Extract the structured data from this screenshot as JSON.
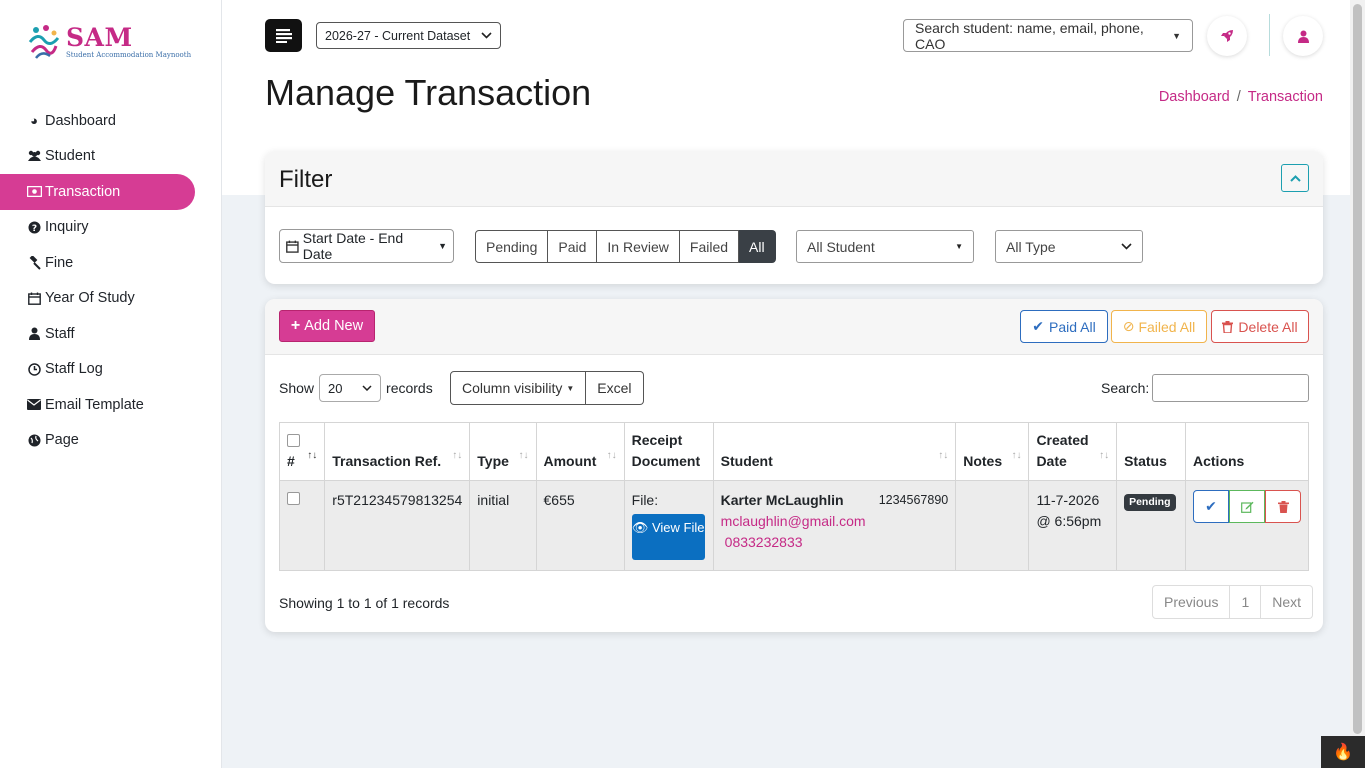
{
  "brand": {
    "title": "SAM",
    "subtitle": "Student Accommodation Maynooth"
  },
  "sidebar": {
    "items": [
      {
        "label": "Dashboard",
        "icon": "tachometer-icon",
        "glyph": "◕"
      },
      {
        "label": "Student",
        "icon": "users-icon",
        "glyph": "👥"
      },
      {
        "label": "Transaction",
        "icon": "money-bill-icon",
        "glyph": "💵",
        "active": true
      },
      {
        "label": "Inquiry",
        "icon": "question-circle-icon",
        "glyph": "❓"
      },
      {
        "label": "Fine",
        "icon": "gavel-icon",
        "glyph": "⚒"
      },
      {
        "label": "Year Of Study",
        "icon": "calendar-icon",
        "glyph": "📅"
      },
      {
        "label": "Staff",
        "icon": "user-icon",
        "glyph": "👤"
      },
      {
        "label": "Staff Log",
        "icon": "clock-icon",
        "glyph": "⏱"
      },
      {
        "label": "Email Template",
        "icon": "envelope-icon",
        "glyph": "✉"
      },
      {
        "label": "Page",
        "icon": "globe-icon",
        "glyph": "🌐"
      }
    ]
  },
  "header": {
    "dataset": "2026-27 - Current Dataset",
    "search_placeholder": "Search student: name, email, phone, CAO",
    "page_title": "Manage Transaction",
    "breadcrumb": [
      "Dashboard",
      "Transaction"
    ]
  },
  "filter": {
    "title": "Filter",
    "date_range": "Start Date - End Date",
    "statuses": [
      "Pending",
      "Paid",
      "In Review",
      "Failed",
      "All"
    ],
    "selected_status": "All",
    "student_select": "All Student",
    "type_select": "All Type"
  },
  "toolbar": {
    "add_new": "Add New",
    "paid_all": "Paid All",
    "failed_all": "Failed All",
    "delete_all": "Delete All"
  },
  "table_controls": {
    "show_label": "Show",
    "page_length": "20",
    "records_label": "records",
    "column_visibility": "Column visibility",
    "excel": "Excel",
    "search_label": "Search:"
  },
  "table": {
    "columns": [
      "#",
      "Transaction Ref.",
      "Type",
      "Amount",
      "Receipt Document",
      "Student",
      "Notes",
      "Created Date",
      "Status",
      "Actions"
    ],
    "rows": [
      {
        "ref": "r5T21234579813254",
        "type": "initial",
        "amount": "€655",
        "receipt_label": "File:",
        "view_file": "View File",
        "student_name": "Karter McLaughlin",
        "student_id": "1234567890",
        "student_email": "mclaughlin@gmail.com",
        "student_phone": "0833232833",
        "notes": "",
        "created": "11-7-2026 @ 6:56pm",
        "status": "Pending"
      }
    ]
  },
  "footer": {
    "showing": "Showing 1 to 1 of 1 records",
    "previous": "Previous",
    "page": "1",
    "next": "Next"
  },
  "colors": {
    "accent": "#d63c94",
    "brand_pink": "#c52a86",
    "primary": "#2d6dbf",
    "success": "#5cb85c",
    "warning": "#f1b44c",
    "danger": "#d9534f"
  }
}
